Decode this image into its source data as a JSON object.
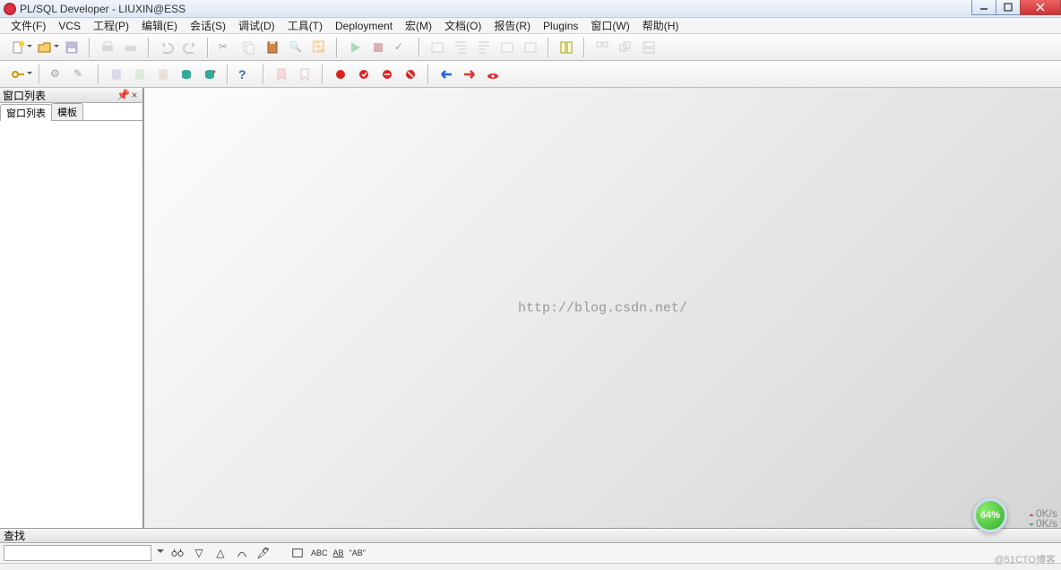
{
  "title": "PL/SQL Developer - LIUXIN@ESS",
  "menu": [
    "文件(F)",
    "VCS",
    "工程(P)",
    "编辑(E)",
    "会话(S)",
    "调试(D)",
    "工具(T)",
    "Deployment",
    "宏(M)",
    "文档(O)",
    "报告(R)",
    "Plugins",
    "窗口(W)",
    "帮助(H)"
  ],
  "side": {
    "header": "窗口列表",
    "tabs": [
      "窗口列表",
      "模板"
    ]
  },
  "watermark": "http://blog.csdn.net/",
  "search": {
    "header": "查找",
    "value": "",
    "ab_label": "ABC",
    "ab2": "AB",
    "ab3": "\"AB\""
  },
  "badge": "64%",
  "net": {
    "up": "0K/s",
    "down": "0K/s"
  },
  "footer_wm": "@51CTO博客"
}
